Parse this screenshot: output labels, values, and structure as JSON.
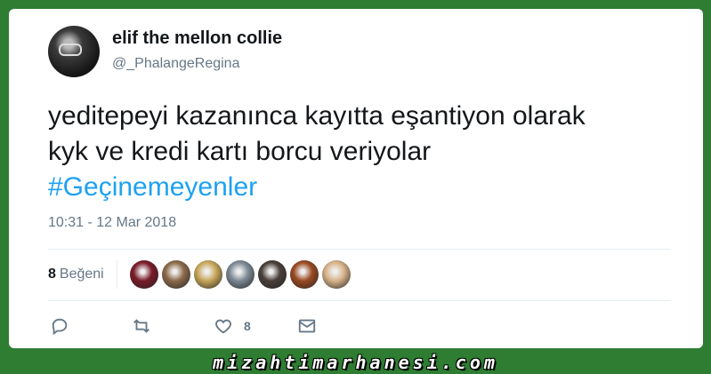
{
  "tweet": {
    "author_name": "elif the mellon collie",
    "author_handle": "@_PhalangeRegina",
    "text_lines": [
      "yeditepeyi kazanınca kayıtta eşantiyon olarak",
      "kyk ve kredi kartı borcu veriyolar"
    ],
    "hashtag": "#Geçinemeyenler",
    "timestamp": "10:31 - 12 Mar 2018",
    "likes_count": "8",
    "likes_label": "Beğeni",
    "like_action_count": "8"
  },
  "liker_avatars": [
    {
      "icon": "avatar-red-figure",
      "color": "#7a1c2a"
    },
    {
      "icon": "avatar-photo-person",
      "color": "#8c6a4a"
    },
    {
      "icon": "avatar-yellow-dog",
      "color": "#c8a75a"
    },
    {
      "icon": "avatar-gray-character",
      "color": "#7d8a95"
    },
    {
      "icon": "avatar-dark-portrait",
      "color": "#4a3f3a"
    },
    {
      "icon": "avatar-orange-hair",
      "color": "#9a4a22"
    },
    {
      "icon": "avatar-hamster",
      "color": "#d8b38a"
    }
  ],
  "watermark": "mizahtimarhanesi.com",
  "colors": {
    "background": "#2e7d32",
    "link": "#1da1f2",
    "secondary_text": "#657786"
  }
}
